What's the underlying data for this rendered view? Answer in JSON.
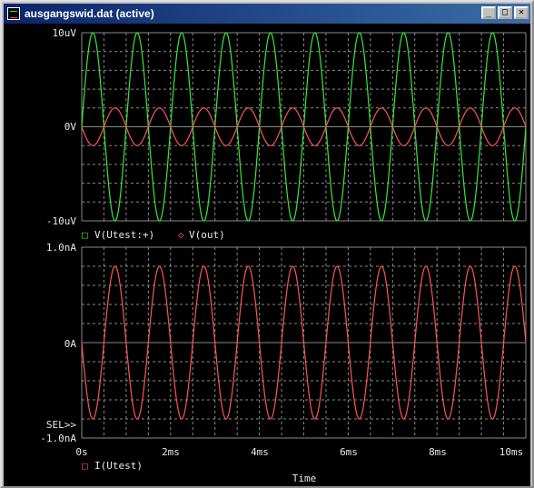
{
  "window": {
    "title": "ausgangswid.dat (active)",
    "minimize_label": "_",
    "maximize_label": "□",
    "close_label": "✕"
  },
  "colors": {
    "background": "#000000",
    "grid": "#8a8a8a",
    "axis_text": "#e8e8e8",
    "series_green": "#39e839",
    "series_red": "#ff5555"
  },
  "plots": {
    "top": {
      "y_ticks": [
        "10uV",
        "0V",
        "-10uV"
      ],
      "legend": [
        {
          "marker": "□",
          "label": "V(Utest:+)"
        },
        {
          "marker": "◇",
          "label": "V(out)"
        }
      ]
    },
    "bottom": {
      "y_ticks": [
        "1.0nA",
        "0A",
        "-1.0nA"
      ],
      "sel_marker": "SEL>>",
      "legend": [
        {
          "marker": "□",
          "label": "I(Utest)"
        }
      ]
    },
    "x_ticks": [
      "0s",
      "2ms",
      "4ms",
      "6ms",
      "8ms",
      "10ms"
    ],
    "x_axis_title": "Time"
  },
  "chart_data": [
    {
      "type": "line",
      "title": "",
      "xlabel": "Time",
      "ylabel": "",
      "xlim": [
        0,
        10
      ],
      "x_units": "ms",
      "ylim": [
        -10,
        10
      ],
      "y_units": "uV",
      "grid": true,
      "legend": "bottom-left",
      "series": [
        {
          "name": "V(Utest:+)",
          "color": "#39e839",
          "waveform": "sine",
          "amplitude": 10,
          "frequency_hz": 1000,
          "phase_deg": 0
        },
        {
          "name": "V(out)",
          "color": "#ff5555",
          "waveform": "sine",
          "amplitude": 2,
          "frequency_hz": 1000,
          "phase_deg": 180
        }
      ]
    },
    {
      "type": "line",
      "title": "",
      "xlabel": "Time",
      "ylabel": "",
      "xlim": [
        0,
        10
      ],
      "x_units": "ms",
      "ylim": [
        -1.0,
        1.0
      ],
      "y_units": "nA",
      "grid": true,
      "legend": "bottom-left",
      "series": [
        {
          "name": "I(Utest)",
          "color": "#ff5555",
          "waveform": "sine",
          "amplitude": 0.8,
          "frequency_hz": 1000,
          "phase_deg": 180
        }
      ]
    }
  ]
}
